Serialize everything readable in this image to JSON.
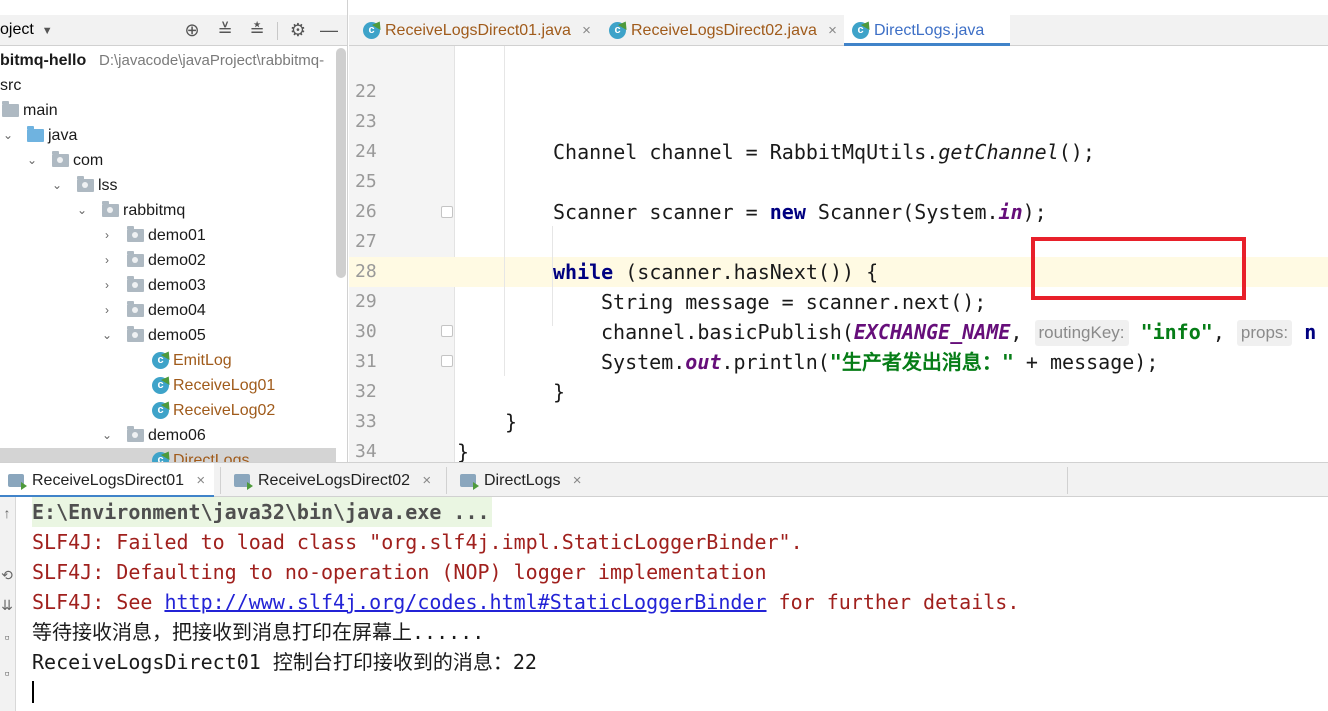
{
  "project_panel": {
    "title": "oject",
    "tree": [
      {
        "label": "bitmq-hello",
        "hint": "D:\\javacode\\javaProject\\rabbitmq-",
        "kind": "module"
      },
      {
        "label": "src",
        "kind": "dir"
      },
      {
        "label": "main",
        "kind": "folder"
      },
      {
        "label": "java",
        "kind": "src-folder"
      },
      {
        "label": "com",
        "kind": "package"
      },
      {
        "label": "lss",
        "kind": "package"
      },
      {
        "label": "rabbitmq",
        "kind": "package"
      },
      {
        "label": "demo01",
        "kind": "package"
      },
      {
        "label": "demo02",
        "kind": "package"
      },
      {
        "label": "demo03",
        "kind": "package"
      },
      {
        "label": "demo04",
        "kind": "package"
      },
      {
        "label": "demo05",
        "kind": "package"
      },
      {
        "label": "EmitLog",
        "kind": "class"
      },
      {
        "label": "ReceiveLog01",
        "kind": "class"
      },
      {
        "label": "ReceiveLog02",
        "kind": "class"
      },
      {
        "label": "demo06",
        "kind": "package"
      },
      {
        "label": "DirectLogs",
        "kind": "class"
      }
    ]
  },
  "editor": {
    "tabs": [
      {
        "label": "ReceiveLogsDirect01.java"
      },
      {
        "label": "ReceiveLogsDirect02.java"
      },
      {
        "label": "DirectLogs.java"
      }
    ],
    "close_glyph": "×",
    "lines": {
      "l22": "22",
      "l23": "23",
      "l24": "24",
      "l25": "25",
      "l26": "26",
      "l27": "27",
      "l28": "28",
      "l29": "29",
      "l30": "30",
      "l31": "31",
      "l32": "32",
      "l33": "33",
      "l34": "34"
    },
    "code": {
      "c23": "Channel channel = RabbitMqUtils.",
      "c23_method": "getChannel",
      "c23_end": "();",
      "c25_a": "Scanner scanner = ",
      "c25_new": "new",
      "c25_b": " Scanner(System.",
      "c25_in": "in",
      "c25_end": ");",
      "c27_kw": "while",
      "c27_rest": " (scanner.hasNext()) {",
      "c28": "String message = scanner.next();",
      "c29_a": "channel.basicPublish(",
      "c29_const": "EXCHANGE_NAME",
      "c29_comma": ", ",
      "c29_hint1": "routingKey:",
      "c29_str": "\"info\"",
      "c29_comma2": ", ",
      "c29_hint2": "props:",
      "c29_tail": "n",
      "c30_a": "System.",
      "c30_out": "out",
      "c30_b": ".println(",
      "c30_str": "\"生产者发出消息：\"",
      "c30_c": " + message);",
      "c31": "}",
      "c32": "}",
      "c33": "}"
    }
  },
  "run_panel": {
    "tabs": [
      {
        "label": "ReceiveLogsDirect01"
      },
      {
        "label": "ReceiveLogsDirect02"
      },
      {
        "label": "DirectLogs"
      }
    ],
    "console": {
      "cmd": "E:\\Environment\\java32\\bin\\java.exe ...",
      "err1": "SLF4J: Failed to load class \"org.slf4j.impl.StaticLoggerBinder\".",
      "err2": "SLF4J: Defaulting to no-operation (NOP) logger implementation",
      "err3_a": "SLF4J: See ",
      "err3_link": "http://www.slf4j.org/codes.html#StaticLoggerBinder",
      "err3_b": " for further details.",
      "out1": "等待接收消息，把接收到消息打印在屏幕上......",
      "out2": "ReceiveLogsDirect01 控制台打印接收到的消息：22"
    }
  },
  "colors": {
    "highlight_box": "#e8202a",
    "keyword": "#000080",
    "string": "#067d17",
    "constant": "#660e7a",
    "error_text": "#a0201d",
    "link": "#2323d6"
  }
}
